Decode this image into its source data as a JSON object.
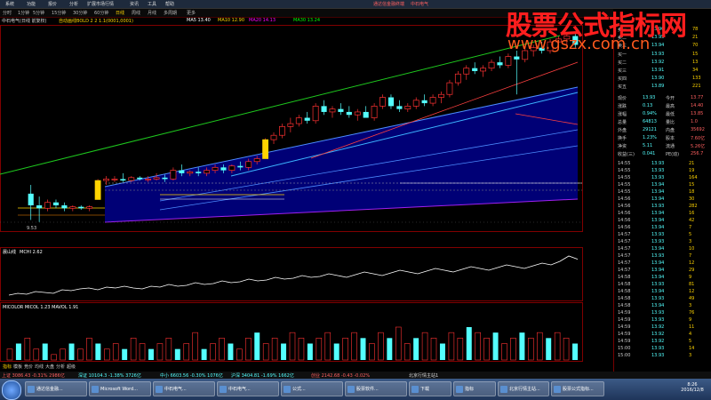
{
  "menu": {
    "items": [
      "系统",
      "功能",
      "报价",
      "分析",
      "扩展市场行情",
      "资讯",
      "工具",
      "帮助"
    ],
    "center_links": [
      "通达信金融终端",
      "中石电气"
    ]
  },
  "periods": {
    "items": [
      "分时",
      "1分钟",
      "5分钟",
      "15分钟",
      "30分钟",
      "60分钟",
      "日线",
      "周线",
      "月线",
      "多周期",
      "更多"
    ],
    "active_index": 6
  },
  "info_line": {
    "left": "中石电气(日线 前复权)",
    "indicator": "自动画线BOLD 2 2 1.1(0001,0001)",
    "ma1": "MA5 13.40",
    "ma2": "MA10 12.90",
    "ma3": "MA20 14.13",
    "ma4": "MA30 13.24"
  },
  "chart_data": [
    {
      "type": "candlestick",
      "panel": "price",
      "low_label": "9.53",
      "candles": [
        {
          "o": 10.5,
          "h": 10.8,
          "l": 9.6,
          "c": 10.1
        },
        {
          "o": 10.1,
          "h": 10.4,
          "l": 9.53,
          "c": 10.0
        },
        {
          "o": 10.0,
          "h": 10.3,
          "l": 9.9,
          "c": 10.2
        },
        {
          "o": 10.2,
          "h": 10.3,
          "l": 10.0,
          "c": 10.1
        },
        {
          "o": 10.1,
          "h": 10.2,
          "l": 9.9,
          "c": 10.0
        },
        {
          "o": 10.0,
          "h": 10.1,
          "l": 9.9,
          "c": 10.05
        },
        {
          "o": 10.05,
          "h": 10.1,
          "l": 9.95,
          "c": 10.0
        },
        {
          "o": 10.0,
          "h": 10.1,
          "l": 9.9,
          "c": 10.05
        },
        {
          "o": 10.3,
          "h": 11.0,
          "l": 10.3,
          "c": 10.95
        },
        {
          "o": 10.95,
          "h": 11.1,
          "l": 10.8,
          "c": 11.0
        },
        {
          "o": 11.0,
          "h": 11.1,
          "l": 10.9,
          "c": 11.0
        },
        {
          "o": 11.0,
          "h": 11.2,
          "l": 10.9,
          "c": 10.95
        },
        {
          "o": 10.95,
          "h": 11.1,
          "l": 10.9,
          "c": 11.05
        },
        {
          "o": 11.05,
          "h": 11.1,
          "l": 10.95,
          "c": 11.0
        },
        {
          "o": 11.0,
          "h": 11.1,
          "l": 10.9,
          "c": 11.0
        },
        {
          "o": 11.0,
          "h": 11.2,
          "l": 10.95,
          "c": 11.05
        },
        {
          "o": 11.05,
          "h": 11.15,
          "l": 10.9,
          "c": 11.0
        },
        {
          "o": 11.0,
          "h": 11.4,
          "l": 10.95,
          "c": 11.3
        },
        {
          "o": 11.3,
          "h": 11.5,
          "l": 11.1,
          "c": 11.2
        },
        {
          "o": 11.2,
          "h": 11.3,
          "l": 11.1,
          "c": 11.25
        },
        {
          "o": 11.25,
          "h": 11.4,
          "l": 11.1,
          "c": 11.2
        },
        {
          "o": 11.2,
          "h": 11.4,
          "l": 11.1,
          "c": 11.3
        },
        {
          "o": 11.3,
          "h": 11.5,
          "l": 11.2,
          "c": 11.4
        },
        {
          "o": 11.4,
          "h": 11.5,
          "l": 11.2,
          "c": 11.3
        },
        {
          "o": 11.3,
          "h": 11.5,
          "l": 11.2,
          "c": 11.45
        },
        {
          "o": 11.45,
          "h": 11.6,
          "l": 11.3,
          "c": 11.4
        },
        {
          "o": 11.4,
          "h": 11.7,
          "l": 11.3,
          "c": 11.6
        },
        {
          "o": 11.6,
          "h": 11.8,
          "l": 11.5,
          "c": 11.7
        },
        {
          "o": 11.7,
          "h": 12.4,
          "l": 11.7,
          "c": 12.35
        },
        {
          "o": 12.35,
          "h": 12.6,
          "l": 12.2,
          "c": 12.5
        },
        {
          "o": 12.5,
          "h": 12.9,
          "l": 12.4,
          "c": 12.8
        },
        {
          "o": 12.8,
          "h": 13.1,
          "l": 12.6,
          "c": 12.9
        },
        {
          "o": 12.9,
          "h": 13.2,
          "l": 12.8,
          "c": 13.1
        },
        {
          "o": 13.1,
          "h": 13.3,
          "l": 12.9,
          "c": 13.0
        },
        {
          "o": 13.0,
          "h": 13.6,
          "l": 12.9,
          "c": 13.5
        },
        {
          "o": 13.5,
          "h": 13.7,
          "l": 13.2,
          "c": 13.3
        },
        {
          "o": 13.3,
          "h": 13.5,
          "l": 13.1,
          "c": 13.4
        },
        {
          "o": 13.4,
          "h": 13.6,
          "l": 13.2,
          "c": 13.3
        },
        {
          "o": 13.3,
          "h": 13.5,
          "l": 13.1,
          "c": 13.2
        },
        {
          "o": 13.2,
          "h": 13.4,
          "l": 13.0,
          "c": 13.3
        },
        {
          "o": 13.3,
          "h": 13.5,
          "l": 13.1,
          "c": 13.1
        },
        {
          "o": 13.1,
          "h": 13.6,
          "l": 13.0,
          "c": 13.5
        },
        {
          "o": 13.5,
          "h": 13.9,
          "l": 13.4,
          "c": 13.8
        },
        {
          "o": 13.8,
          "h": 13.9,
          "l": 13.4,
          "c": 13.5
        },
        {
          "o": 13.5,
          "h": 13.7,
          "l": 13.3,
          "c": 13.4
        },
        {
          "o": 13.4,
          "h": 13.6,
          "l": 13.3,
          "c": 13.5
        },
        {
          "o": 13.5,
          "h": 13.8,
          "l": 13.4,
          "c": 13.7
        },
        {
          "o": 13.7,
          "h": 13.9,
          "l": 13.5,
          "c": 13.6
        },
        {
          "o": 13.6,
          "h": 13.9,
          "l": 13.5,
          "c": 13.8
        },
        {
          "o": 13.8,
          "h": 14.0,
          "l": 13.6,
          "c": 13.9
        },
        {
          "o": 13.9,
          "h": 14.4,
          "l": 13.8,
          "c": 14.3
        },
        {
          "o": 14.3,
          "h": 14.7,
          "l": 14.2,
          "c": 14.6
        },
        {
          "o": 14.6,
          "h": 14.9,
          "l": 14.4,
          "c": 14.8
        },
        {
          "o": 14.8,
          "h": 15.0,
          "l": 14.6,
          "c": 14.7
        },
        {
          "o": 14.7,
          "h": 14.9,
          "l": 14.5,
          "c": 14.8
        },
        {
          "o": 14.8,
          "h": 15.1,
          "l": 14.7,
          "c": 15.0
        },
        {
          "o": 15.0,
          "h": 15.2,
          "l": 14.8,
          "c": 14.9
        },
        {
          "o": 14.9,
          "h": 15.3,
          "l": 14.8,
          "c": 15.2
        },
        {
          "o": 15.2,
          "h": 15.4,
          "l": 13.9,
          "c": 15.1
        },
        {
          "o": 15.1,
          "h": 15.5,
          "l": 15.0,
          "c": 15.4
        },
        {
          "o": 15.4,
          "h": 15.6,
          "l": 15.2,
          "c": 15.5
        },
        {
          "o": 15.5,
          "h": 15.7,
          "l": 15.3,
          "c": 15.4
        },
        {
          "o": 15.4,
          "h": 15.8,
          "l": 15.3,
          "c": 15.7
        },
        {
          "o": 15.7,
          "h": 15.9,
          "l": 15.5,
          "c": 15.8
        },
        {
          "o": 15.8,
          "h": 16.0,
          "l": 15.6,
          "c": 15.9
        },
        {
          "o": 15.9,
          "h": 16.0,
          "l": 15.5,
          "c": 15.6
        }
      ]
    },
    {
      "type": "line",
      "panel": "indicator",
      "label": "晨山线",
      "label2": "MCHI 2.62",
      "values": [
        0.6,
        0.7,
        0.65,
        0.8,
        0.75,
        0.7,
        0.9,
        0.85,
        0.95,
        1.0,
        0.9,
        1.05,
        1.0,
        1.1,
        1.0,
        0.95,
        1.1,
        1.05,
        1.2,
        1.1,
        1.15,
        1.3,
        1.2,
        1.25,
        1.4,
        1.3,
        1.35,
        1.5,
        1.4,
        1.45,
        1.6,
        1.5,
        1.55,
        1.7,
        1.6,
        1.65,
        1.8,
        1.7,
        1.6,
        1.75,
        1.9,
        1.8,
        1.7,
        1.85,
        2.0,
        1.9,
        1.8,
        1.95,
        2.1,
        2.0,
        1.9,
        2.05,
        2.2,
        2.1,
        2.0,
        2.15,
        2.3,
        2.2,
        2.1,
        2.25,
        2.4,
        2.3,
        2.5,
        2.8,
        2.62
      ]
    },
    {
      "type": "bar",
      "panel": "volume",
      "label": "MICOLOR MICOL 1.23 MAVOL 1.91",
      "values": [
        2,
        3,
        4,
        2,
        3,
        1,
        2,
        3,
        2,
        4,
        3,
        2,
        3,
        2,
        4,
        3,
        2,
        3,
        4,
        2,
        3,
        5,
        2,
        3,
        4,
        3,
        2,
        4,
        5,
        3,
        4,
        3,
        5,
        4,
        3,
        4,
        5,
        3,
        4,
        5,
        4,
        3,
        5,
        4,
        6,
        3,
        4,
        5,
        4,
        3,
        5,
        4,
        6,
        5,
        4,
        5,
        3,
        4,
        5,
        4,
        5,
        4,
        5,
        4,
        3
      ]
    }
  ],
  "right_panel": {
    "order_book": [
      {
        "label": "卖一",
        "price": "13.96",
        "vol": "78"
      },
      {
        "label": "卖二",
        "price": "13.95",
        "vol": "21"
      },
      {
        "label": "卖三",
        "price": "13.94",
        "vol": "70"
      },
      {
        "label": "买一",
        "price": "13.93",
        "vol": "15"
      },
      {
        "label": "买二",
        "price": "13.92",
        "vol": "13"
      },
      {
        "label": "买三",
        "price": "13.91",
        "vol": "34"
      },
      {
        "label": "买四",
        "price": "13.90",
        "vol": "133"
      },
      {
        "label": "买五",
        "price": "13.89",
        "vol": "221"
      }
    ],
    "stats": [
      {
        "l1": "现价",
        "v1": "13.93",
        "l2": "今开",
        "v2": "13.77"
      },
      {
        "l1": "涨跌",
        "v1": "0.13",
        "l2": "最高",
        "v2": "14.40"
      },
      {
        "l1": "涨幅",
        "v1": "0.94%",
        "l2": "最低",
        "v2": "13.85"
      },
      {
        "l1": "总量",
        "v1": "64813",
        "l2": "量比",
        "v2": "1.0"
      },
      {
        "l1": "外盘",
        "v1": "29121",
        "l2": "内盘",
        "v2": "35692"
      },
      {
        "l1": "换手",
        "v1": "1.23%",
        "l2": "股本",
        "v2": "7.60亿"
      },
      {
        "l1": "净资",
        "v1": "5.11",
        "l2": "流通",
        "v2": "5.26亿"
      },
      {
        "l1": "收益(三)",
        "v1": "0.041",
        "l2": "PE(动)",
        "v2": "256.7"
      }
    ],
    "ticks": [
      {
        "t": "14:55",
        "p": "13.93",
        "v": "21"
      },
      {
        "t": "14:55",
        "p": "13.93",
        "v": "19"
      },
      {
        "t": "14:55",
        "p": "13.93",
        "v": "164"
      },
      {
        "t": "14:55",
        "p": "13.94",
        "v": "15"
      },
      {
        "t": "14:55",
        "p": "13.94",
        "v": "18"
      },
      {
        "t": "14:56",
        "p": "13.94",
        "v": "30"
      },
      {
        "t": "14:56",
        "p": "13.93",
        "v": "282"
      },
      {
        "t": "14:56",
        "p": "13.94",
        "v": "16"
      },
      {
        "t": "14:56",
        "p": "13.94",
        "v": "42"
      },
      {
        "t": "14:56",
        "p": "13.94",
        "v": "7"
      },
      {
        "t": "14:57",
        "p": "13.93",
        "v": "5"
      },
      {
        "t": "14:57",
        "p": "13.93",
        "v": "3"
      },
      {
        "t": "14:57",
        "p": "13.94",
        "v": "10"
      },
      {
        "t": "14:57",
        "p": "13.93",
        "v": "7"
      },
      {
        "t": "14:57",
        "p": "13.94",
        "v": "12"
      },
      {
        "t": "14:57",
        "p": "13.94",
        "v": "29"
      },
      {
        "t": "14:58",
        "p": "13.94",
        "v": "9"
      },
      {
        "t": "14:58",
        "p": "13.93",
        "v": "81"
      },
      {
        "t": "14:58",
        "p": "13.94",
        "v": "12"
      },
      {
        "t": "14:58",
        "p": "13.93",
        "v": "49"
      },
      {
        "t": "14:58",
        "p": "13.94",
        "v": "3"
      },
      {
        "t": "14:59",
        "p": "13.93",
        "v": "76"
      },
      {
        "t": "14:59",
        "p": "13.93",
        "v": "9"
      },
      {
        "t": "14:59",
        "p": "13.92",
        "v": "11"
      },
      {
        "t": "14:59",
        "p": "13.92",
        "v": "4"
      },
      {
        "t": "14:59",
        "p": "13.92",
        "v": "5"
      },
      {
        "t": "15:00",
        "p": "13.93",
        "v": "14"
      },
      {
        "t": "15:00",
        "p": "13.93",
        "v": "3"
      }
    ]
  },
  "status_bar": {
    "sh": "上证 3086.43 -0.31% 2986亿",
    "sz": "深证 10104.3 -1.38% 3726亿",
    "zx": "中小 6603.56 -0.30% 1076亿",
    "cy": "创业 2142.68 -0.43 -0.02%",
    "hs": "沪深 3404.81 -1.69% 1662亿",
    "right": "北京行情主站1"
  },
  "taskbar": {
    "buttons": [
      "通达信金融...",
      "Microsoft Word...",
      "中石电气...",
      "中石电气...",
      "公式...",
      "股票软件...",
      "下载",
      "指标",
      "北京行情主站...",
      "股票公式指标..."
    ],
    "time": "8:26",
    "date": "2016/12/8"
  },
  "bottom_tabs": [
    "指标",
    "模板",
    "竞价",
    "均线",
    "大盘",
    "分析",
    "超级"
  ],
  "watermark": {
    "title": "股票公式指标网",
    "url": "www.gszx.com.cn"
  },
  "colors": {
    "up": "#ff3232",
    "down": "#54ffff",
    "ma_yellow": "#ffd400",
    "channel_fill": "#00008b"
  }
}
